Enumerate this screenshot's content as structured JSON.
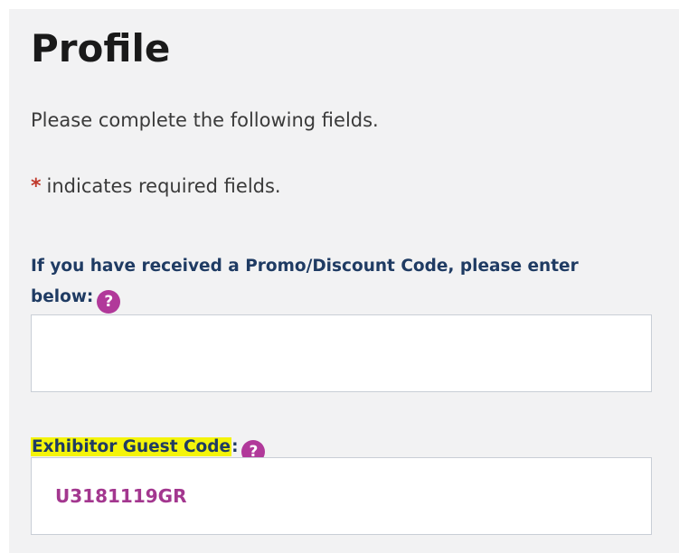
{
  "page": {
    "title": "Profile",
    "intro": "Please complete the following fields.",
    "required_marker": "*",
    "required_note": "indicates required fields."
  },
  "fields": {
    "promo": {
      "label": "If you have received a Promo/Discount Code, please enter below:",
      "help_glyph": "?",
      "value": "",
      "placeholder": ""
    },
    "guest": {
      "label": "Exhibitor Guest Code",
      "label_suffix": ":",
      "help_glyph": "?",
      "value": "U3181119GR"
    }
  },
  "colors": {
    "title": "#1a1a1a",
    "label": "#1f3b63",
    "help_icon": "#b1399a",
    "input_value": "#a3378f",
    "highlight": "#f4f40a",
    "required": "#c0392b",
    "panel_bg": "#f2f2f3"
  },
  "icons": {
    "help": "question-circle-icon",
    "required": "asterisk-icon"
  }
}
